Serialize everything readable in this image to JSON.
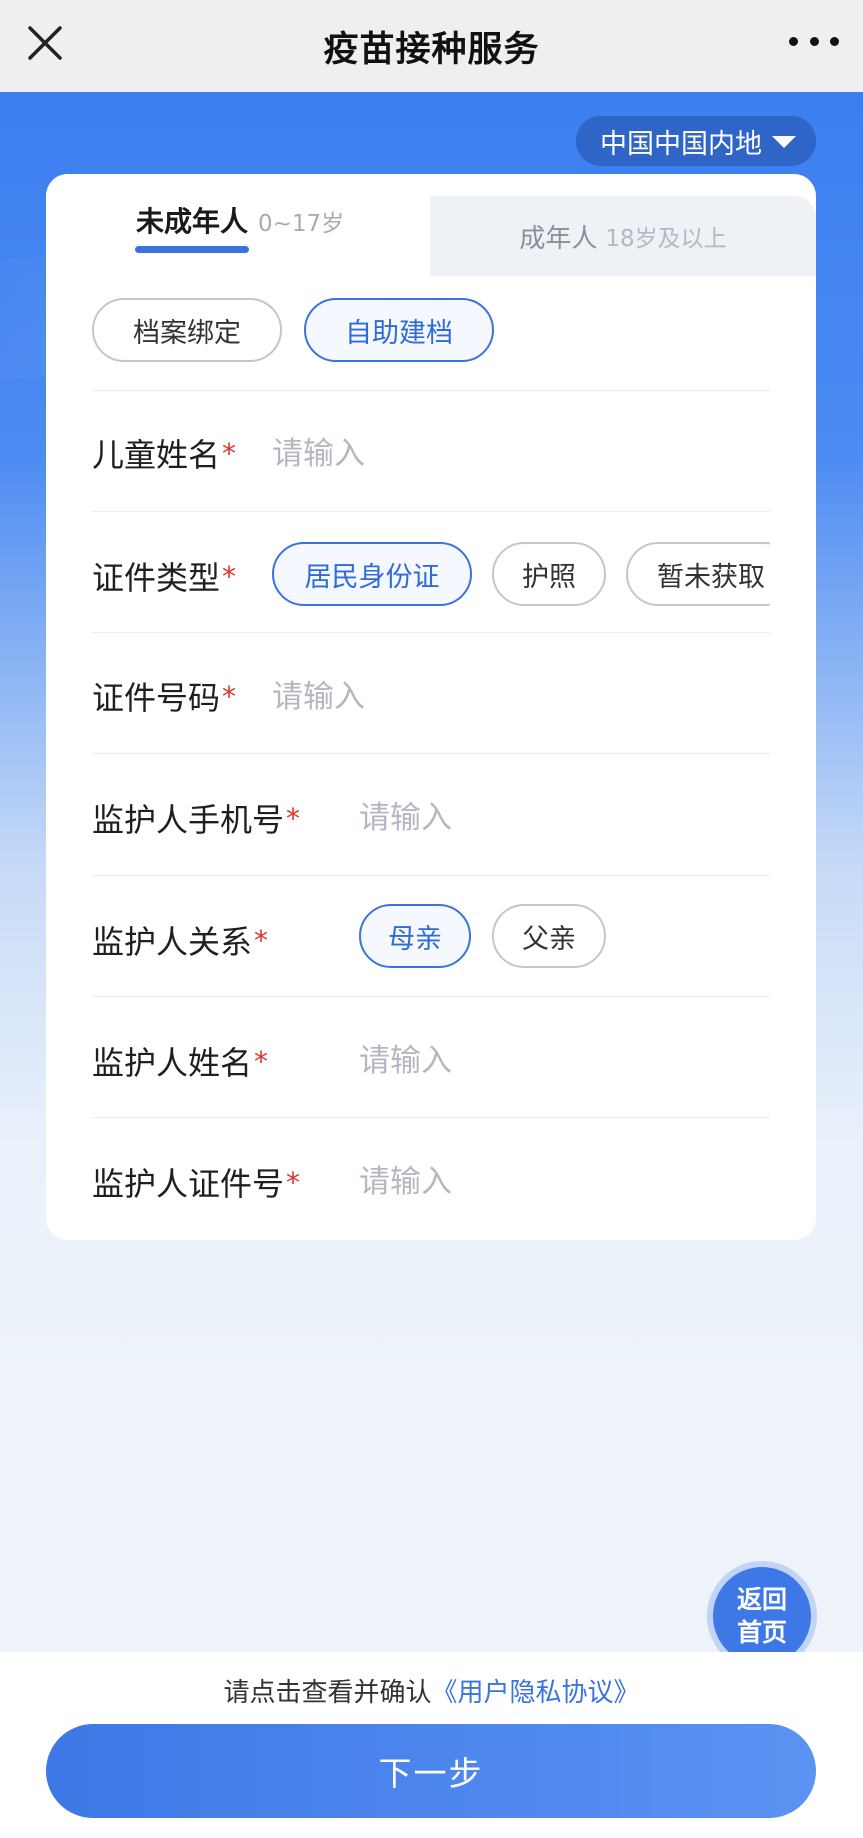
{
  "header": {
    "title": "疫苗接种服务",
    "close_icon": "close-icon",
    "more_icon": "more-icon"
  },
  "region_selector": {
    "label": "中国中国内地",
    "icon": "caret-down-icon"
  },
  "tabs": [
    {
      "label": "未成年人",
      "sub": "0~17岁",
      "selected": true
    },
    {
      "label": "成年人",
      "sub": "18岁及以上",
      "selected": false
    }
  ],
  "mode_options": [
    {
      "label": "档案绑定",
      "selected": false
    },
    {
      "label": "自助建档",
      "selected": true
    }
  ],
  "fields": {
    "child_name": {
      "label": "儿童姓名",
      "required_mark": "*",
      "placeholder": "请输入",
      "value": ""
    },
    "id_type": {
      "label": "证件类型",
      "required_mark": "*",
      "options": [
        {
          "label": "居民身份证",
          "selected": true
        },
        {
          "label": "护照",
          "selected": false
        },
        {
          "label": "暂未获取",
          "selected": false
        }
      ]
    },
    "id_number": {
      "label": "证件号码",
      "required_mark": "*",
      "placeholder": "请输入",
      "value": ""
    },
    "guardian_phone": {
      "label": "监护人手机号",
      "required_mark": "*",
      "placeholder": "请输入",
      "value": ""
    },
    "guardian_relation": {
      "label": "监护人关系",
      "required_mark": "*",
      "options": [
        {
          "label": "母亲",
          "selected": true
        },
        {
          "label": "父亲",
          "selected": false
        }
      ]
    },
    "guardian_name": {
      "label": "监护人姓名",
      "required_mark": "*",
      "placeholder": "请输入",
      "value": ""
    },
    "guardian_id": {
      "label": "监护人证件号",
      "required_mark": "*",
      "placeholder": "请输入",
      "value": ""
    }
  },
  "home_button": {
    "line1": "返回",
    "line2": "首页"
  },
  "footer": {
    "agree_text": "请点击查看并确认",
    "agree_link": "《用户隐私协议》",
    "next_label": "下一步"
  },
  "colors": {
    "accent": "#3a73e0",
    "required": "#e0322d",
    "region_bg": "#2f65c7"
  }
}
